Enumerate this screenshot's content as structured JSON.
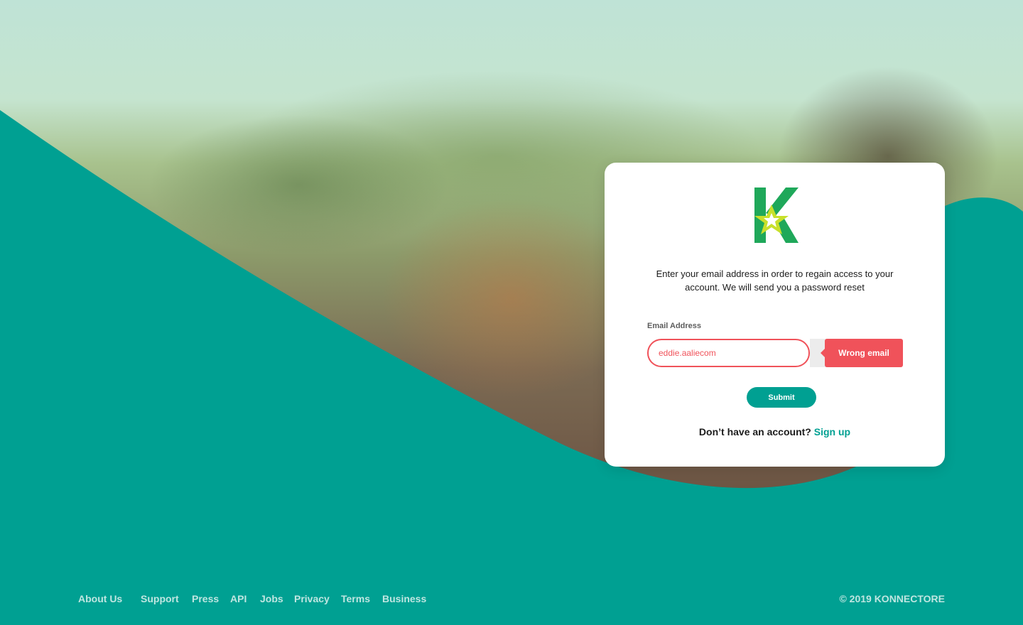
{
  "brand": {
    "name": "KONNECTORE",
    "primary_color": "#00a092",
    "error_color": "#f0525a",
    "logo_icon": "konnectore-k-star-logo"
  },
  "card": {
    "intro_text": "Enter your email address in order to regain access to your account. We will send you a password reset",
    "email_label": "Email Address",
    "email_value": "eddie.aaliecom",
    "error_message": "Wrong email",
    "submit_label": "Submit",
    "signup_prompt": "Don’t have an account?",
    "signup_link": "Sign up"
  },
  "footer": {
    "links": [
      "About Us",
      "Support",
      "Press",
      "API",
      "Jobs",
      "Privacy",
      "Terms",
      "Business"
    ],
    "copyright": "© 2019 KONNECTORE"
  }
}
